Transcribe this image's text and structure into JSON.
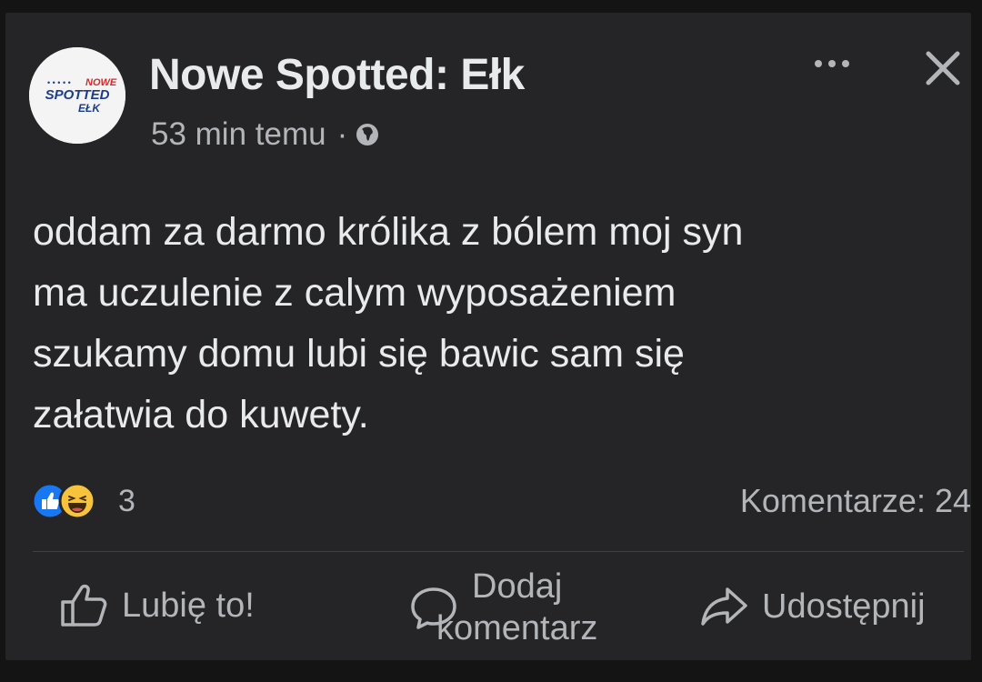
{
  "post": {
    "page_name": "Nowe Spotted: Ełk",
    "time_ago": "53 min temu",
    "separator": "·",
    "privacy_icon": "globe-icon",
    "text": "oddam za darmo królika z bólem moj syn\nma uczulenie z calym wyposażeniem\nszukamy domu lubi się bawic sam się\nzałatwia do kuwety."
  },
  "avatar": {
    "logo_top": "NOWE",
    "logo_main": "SPOTTED",
    "logo_sub": "EŁK"
  },
  "reactions": {
    "icons": [
      "like-icon",
      "haha-icon"
    ],
    "count": "3"
  },
  "comments": {
    "count_label": "Komentarze: 24"
  },
  "actions": {
    "like_label": "Lubię to!",
    "comment_label": "Dodaj\nkomentarz",
    "share_label": "Udostępnij"
  },
  "colors": {
    "background": "#141414",
    "card": "#252527",
    "primary_text": "#e9eaec",
    "secondary_text": "#b3b5b9",
    "like_blue": "#1877f2",
    "haha_yellow": "#f7c23c"
  }
}
